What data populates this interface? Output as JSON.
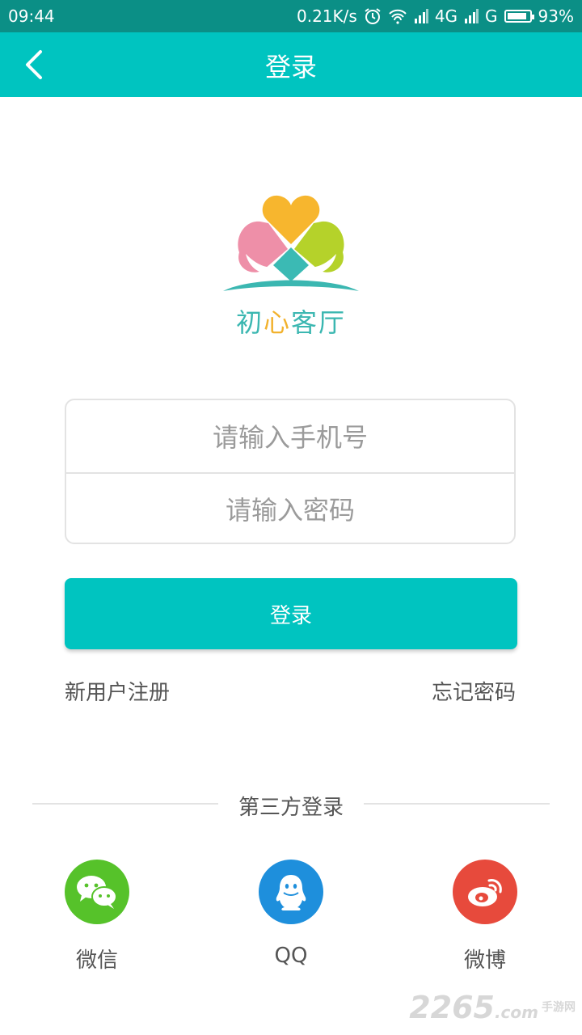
{
  "status_bar": {
    "time": "09:44",
    "net_speed": "0.21K/s",
    "network_1": "4G",
    "network_2": "G",
    "battery": "93%",
    "battery_level": 0.93
  },
  "app_bar": {
    "title": "登录",
    "back_icon": "chevron-left-icon"
  },
  "logo": {
    "brand_chars": [
      "初",
      "心",
      "客",
      "厅"
    ],
    "brand_colors": [
      "#3bb7b1",
      "#f2b22e",
      "#3bb7b1",
      "#3bb7b1"
    ],
    "petal_colors": {
      "top": "#f7b62e",
      "left": "#ee8fa8",
      "right": "#b5d22a",
      "center": "#3bbab4"
    }
  },
  "form": {
    "phone_placeholder": "请输入手机号",
    "phone_value": "",
    "password_placeholder": "请输入密码",
    "password_value": ""
  },
  "login_button": "登录",
  "links": {
    "register": "新用户注册",
    "forgot": "忘记密码"
  },
  "third_party": {
    "title": "第三方登录",
    "providers": [
      {
        "label": "微信",
        "icon": "wechat-icon",
        "color": "#56c22a"
      },
      {
        "label": "QQ",
        "icon": "qq-icon",
        "color": "#1e8fdc"
      },
      {
        "label": "微博",
        "icon": "weibo-icon",
        "color": "#e74a3c"
      }
    ]
  },
  "watermark": {
    "number": "2265",
    "suffix": ".com",
    "site": "手游网"
  },
  "colors": {
    "accent": "#00c4c0",
    "status_bar": "#0b8f86"
  }
}
